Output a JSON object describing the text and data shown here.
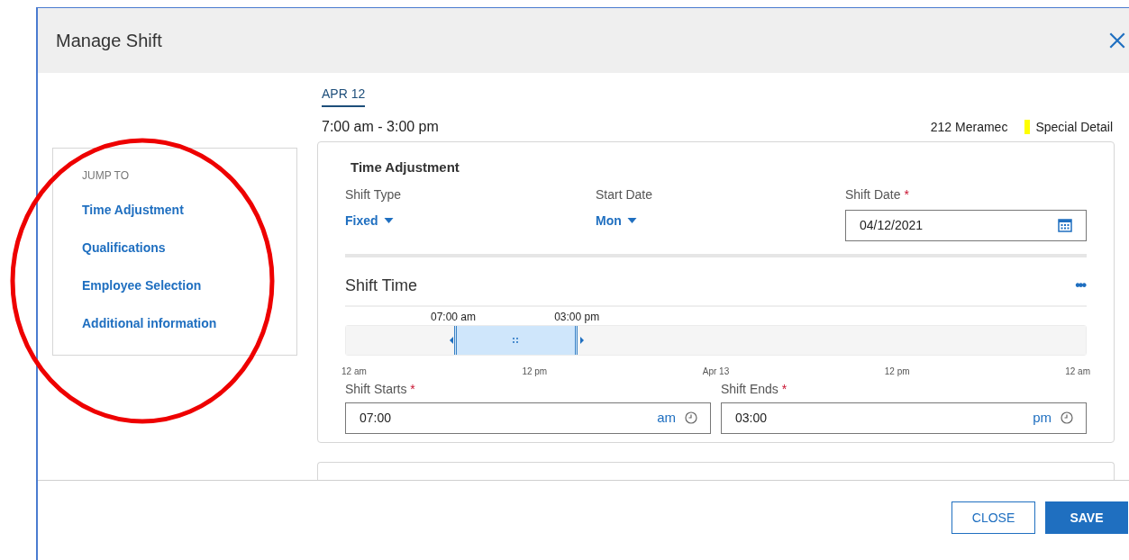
{
  "window": {
    "title": "Manage Shift"
  },
  "jump_to": {
    "heading": "JUMP TO",
    "items": [
      "Time Adjustment",
      "Qualifications",
      "Employee Selection",
      "Additional information"
    ]
  },
  "date_tab": {
    "label": "APR 12",
    "selected": true
  },
  "shift_hours": "7:00 am - 3:00 pm",
  "location": "212 Meramec",
  "tag": {
    "label": "Special Detail",
    "color": "#ffff00"
  },
  "time_adjustment": {
    "title": "Time Adjustment",
    "shift_type": {
      "label": "Shift Type",
      "value": "Fixed"
    },
    "start_date": {
      "label": "Start Date",
      "value": "Mon"
    },
    "shift_date": {
      "label": "Shift Date",
      "required_mark": "*",
      "value": "04/12/2021"
    }
  },
  "shift_time": {
    "title": "Shift Time",
    "more": "•••",
    "segments": [
      {
        "kind": "gap",
        "level": 0.1458
      },
      {
        "kind": "selected",
        "level": 0.1667,
        "start_label": "07:00 am",
        "end_label": "03:00 pm"
      },
      {
        "kind": "gap",
        "level": 0.6875
      }
    ],
    "axis": [
      "12 am",
      "12 pm",
      "Apr 13",
      "12 pm",
      "12 am"
    ],
    "starts": {
      "label": "Shift Starts",
      "required_mark": "*",
      "value": "07:00",
      "meridiem": "am"
    },
    "ends": {
      "label": "Shift Ends",
      "required_mark": "*",
      "value": "03:00",
      "meridiem": "pm"
    }
  },
  "buttons": [
    {
      "label": "CLOSE",
      "kind": "secondary"
    },
    {
      "label": "SAVE",
      "kind": "primary"
    }
  ]
}
